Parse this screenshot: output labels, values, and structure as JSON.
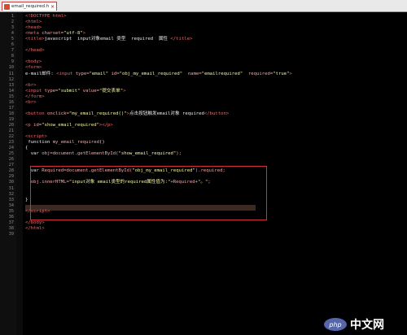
{
  "tab": {
    "label": "email_required.html",
    "close": "×"
  },
  "lines": [
    {
      "n": "1",
      "html": "<span class='t'>&lt;!DOCTYPE html&gt;</span>"
    },
    {
      "n": "2",
      "html": "<span class='t'>&lt;html&gt;</span>"
    },
    {
      "n": "3",
      "html": "<span class='t'>&lt;head&gt;</span>"
    },
    {
      "n": "4",
      "html": "<span class='t'>&lt;meta </span><span class='a'>charset=</span><span class='s'>\"utf-8\"</span><span class='t'>&gt;</span>"
    },
    {
      "n": "5",
      "html": "<span class='t'>&lt;title&gt;</span><span class='k'>javascript  input对象email 类型  required  属性 </span><span class='t'>&lt;/title&gt;</span>"
    },
    {
      "n": "6",
      "html": ""
    },
    {
      "n": "7",
      "html": "<span class='t'>&lt;/head&gt;</span>"
    },
    {
      "n": "8",
      "html": ""
    },
    {
      "n": "9",
      "html": "<span class='t'>&lt;body&gt;</span>"
    },
    {
      "n": "10",
      "html": "<span class='t'>&lt;form&gt;</span>"
    },
    {
      "n": "11",
      "html": "<span class='k'>e-mail邮件: </span><span class='t'>&lt;input </span><span class='a'>type=</span><span class='s'>\"email\"</span><span class='a'> id=</span><span class='s'>\"obj_my_email_required\"</span><span class='a'>  name=</span><span class='s'>\"emailrequired\"</span><span class='a'>  required=</span><span class='s'>\"true\"</span><span class='t'>&gt;</span>"
    },
    {
      "n": "12",
      "html": ""
    },
    {
      "n": "13",
      "html": "<span class='t'>&lt;br&gt;</span>"
    },
    {
      "n": "14",
      "html": "<span class='t'>&lt;input </span><span class='a'>type=</span><span class='s'>\"submit\"</span><span class='a'> value=</span><span class='s'>\"提交表单\"</span><span class='t'>&gt;</span>"
    },
    {
      "n": "15",
      "html": "<span class='t'>&lt;/form&gt;</span>"
    },
    {
      "n": "16",
      "html": "<span class='t'>&lt;br&gt;</span>"
    },
    {
      "n": "17",
      "html": ""
    },
    {
      "n": "18",
      "html": "<span class='t'>&lt;button </span><span class='a'>onclick=</span><span class='s'>\"my_email_required()\"</span><span class='t'>&gt;</span><span class='k'>点击按钮触发email对象 required</span><span class='t'>&lt;/button&gt;</span>"
    },
    {
      "n": "19",
      "html": ""
    },
    {
      "n": "20",
      "html": "<span class='t'>&lt;p </span><span class='a'>id=</span><span class='s'>\"show_email_required\"</span><span class='t'>&gt;&lt;/p&gt;</span>"
    },
    {
      "n": "21",
      "html": ""
    },
    {
      "n": "22",
      "html": "<span class='t'>&lt;script&gt;</span>"
    },
    {
      "n": "23",
      "html": "<span class='k'> function </span><span class='a'>my_email_required</span><span class='k'>()</span>"
    },
    {
      "n": "24",
      "html": "<span class='k'>{</span>"
    },
    {
      "n": "25",
      "html": "<span class='k'>  var </span><span class='a'>obj=document.getElementById(</span><span class='s'>\"show_email_required\"</span><span class='a'>);</span>"
    },
    {
      "n": "26",
      "html": ""
    },
    {
      "n": "27",
      "html": ""
    },
    {
      "n": "28",
      "html": "<span class='k'>  var </span><span class='a'>Required=document.getElementById(</span><span class='s'>\"obj_my_email_required\"</span><span class='a'>).required;</span>"
    },
    {
      "n": "29",
      "html": ""
    },
    {
      "n": "30",
      "html": "<span class='a'>  obj.innerHTML=</span><span class='s'>\"input对象 email类型的required属性值为:\"</span><span class='a'>+Required+</span><span class='s'>\"。\"</span><span class='a'>;</span>"
    },
    {
      "n": "31",
      "html": ""
    },
    {
      "n": "32",
      "html": ""
    },
    {
      "n": "33",
      "html": "<span class='k'>}</span>"
    },
    {
      "n": "34",
      "html": ""
    },
    {
      "n": "35",
      "html": "<span class='t'>&lt;/script&gt;</span>"
    },
    {
      "n": "36",
      "html": ""
    },
    {
      "n": "37",
      "html": "<span class='t'>&lt;/body&gt;</span>"
    },
    {
      "n": "38",
      "html": "<span class='t'>&lt;/html&gt;</span>"
    },
    {
      "n": "39",
      "html": ""
    }
  ],
  "watermark": {
    "logo": "php",
    "text": "中文网"
  }
}
